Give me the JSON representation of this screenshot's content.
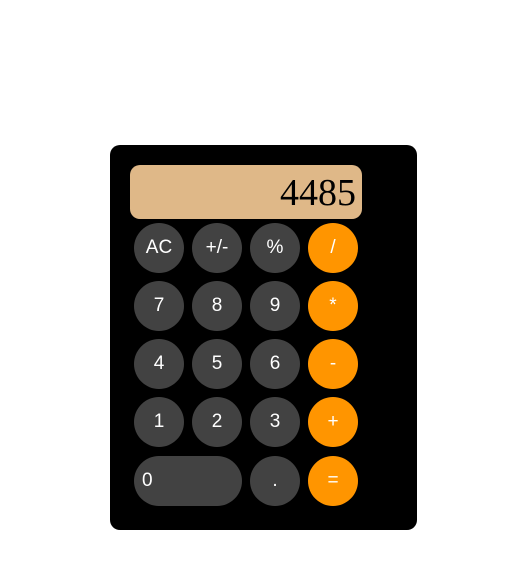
{
  "calculator": {
    "display_value": "4485",
    "buttons": {
      "ac": "AC",
      "plus_minus": "+/-",
      "percent": "%",
      "divide": "/",
      "seven": "7",
      "eight": "8",
      "nine": "9",
      "multiply": "*",
      "four": "4",
      "five": "5",
      "six": "6",
      "subtract": "-",
      "one": "1",
      "two": "2",
      "three": "3",
      "add": "+",
      "zero": "0",
      "decimal": ".",
      "equals": "="
    }
  },
  "colors": {
    "background": "#ffffff",
    "body": "#000000",
    "display": "#dfb888",
    "number_button": "#424242",
    "operator_button": "#ff9500",
    "button_text": "#ffffff"
  }
}
